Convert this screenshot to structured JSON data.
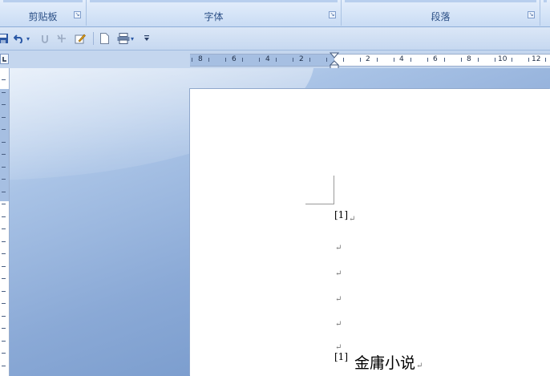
{
  "ribbon": {
    "groups": [
      {
        "title": "剪贴板"
      },
      {
        "title": "字体"
      },
      {
        "title": "段落"
      }
    ]
  },
  "ruler": {
    "left_numbers": [
      "8",
      "6",
      "4",
      "2"
    ],
    "right_numbers": [
      "2",
      "4",
      "6",
      "8",
      "10",
      "12"
    ]
  },
  "document": {
    "paragraphs": [
      {
        "note": "[1]",
        "text": "",
        "mark": "↵"
      },
      {
        "note": "",
        "text": "",
        "mark": "↵"
      },
      {
        "note": "",
        "text": "",
        "mark": "↵"
      },
      {
        "note": "",
        "text": "",
        "mark": "↵"
      },
      {
        "note": "",
        "text": "",
        "mark": "↵"
      },
      {
        "note": "",
        "text": "",
        "mark": "↵"
      },
      {
        "note": "[1]",
        "text": "金庸小说",
        "mark": "↵"
      }
    ]
  },
  "icons": [
    "save-icon",
    "undo-icon",
    "dropdown-icon",
    "redo-icon",
    "repeat-icon",
    "edit-icon",
    "new-document-icon",
    "print-layout-icon",
    "customize-toolbar-icon"
  ],
  "colors": {
    "ribbon_text": "#2b4f86",
    "workspace": "#6f93c4",
    "page": "#ffffff"
  }
}
